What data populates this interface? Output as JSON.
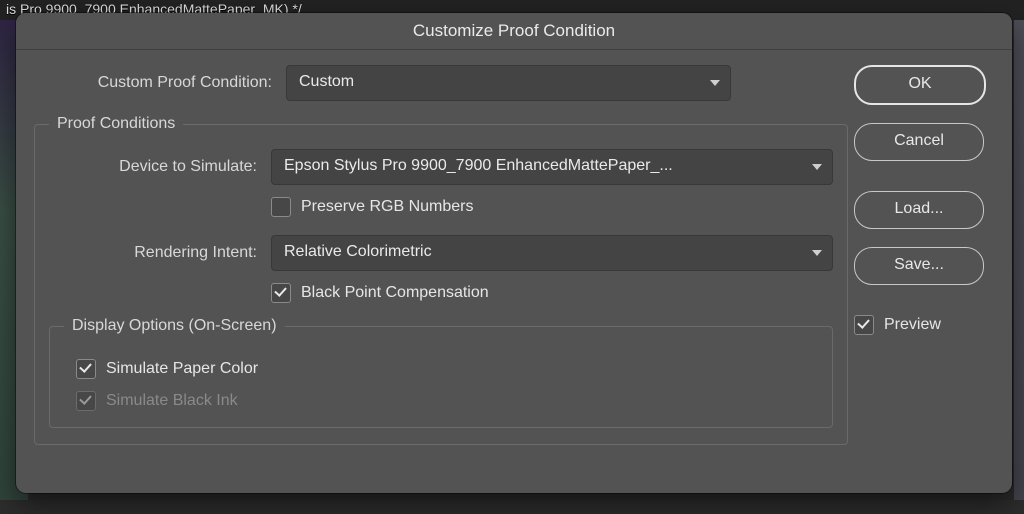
{
  "background": {
    "document_tab": "is Pro 9900_7900 EnhancedMattePaper_MK) */"
  },
  "dialog": {
    "title": "Customize Proof Condition",
    "custom_proof_condition": {
      "label": "Custom Proof Condition:",
      "value": "Custom"
    },
    "proof_conditions": {
      "legend": "Proof Conditions",
      "device_to_simulate": {
        "label": "Device to Simulate:",
        "value": "Epson Stylus Pro 9900_7900 EnhancedMattePaper_..."
      },
      "preserve_rgb": {
        "label": "Preserve RGB Numbers",
        "checked": false
      },
      "rendering_intent": {
        "label": "Rendering Intent:",
        "value": "Relative Colorimetric"
      },
      "black_point_comp": {
        "label": "Black Point Compensation",
        "checked": true
      }
    },
    "display_options": {
      "legend": "Display Options (On-Screen)",
      "simulate_paper_color": {
        "label": "Simulate Paper Color",
        "checked": true
      },
      "simulate_black_ink": {
        "label": "Simulate Black Ink",
        "checked": true,
        "disabled": true
      }
    },
    "buttons": {
      "ok": "OK",
      "cancel": "Cancel",
      "load": "Load...",
      "save": "Save..."
    },
    "preview": {
      "label": "Preview",
      "checked": true
    }
  }
}
